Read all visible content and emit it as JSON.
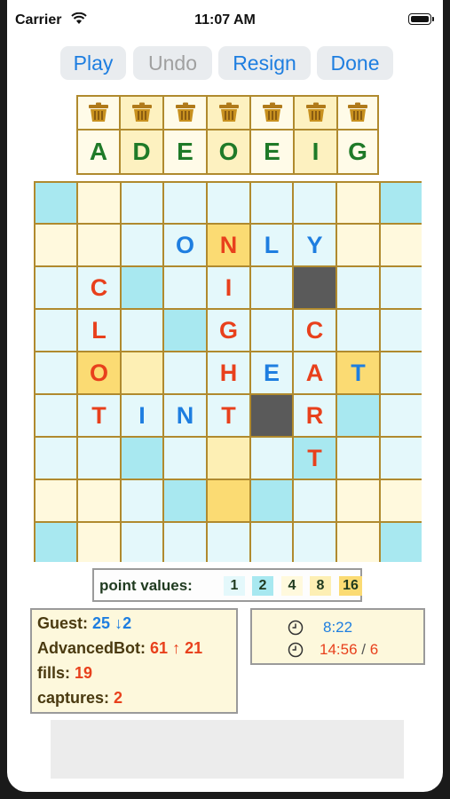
{
  "status_bar": {
    "carrier": "Carrier",
    "time": "11:07 AM"
  },
  "toolbar": {
    "play": "Play",
    "undo": "Undo",
    "resign": "Resign",
    "done": "Done"
  },
  "tray": {
    "letters": [
      "A",
      "D",
      "E",
      "O",
      "E",
      "I",
      "G"
    ],
    "highlighted": [
      false,
      true,
      false,
      true,
      false,
      true,
      false
    ],
    "trash_icon": "trash-basket-icon"
  },
  "board": {
    "size": 9,
    "rows": [
      [
        "",
        "",
        "",
        "",
        "",
        "",
        "",
        "",
        ""
      ],
      [
        "",
        "",
        "",
        "O",
        "N",
        "L",
        "Y",
        "",
        ""
      ],
      [
        "",
        "C",
        "",
        "",
        "I",
        "",
        "",
        "",
        ""
      ],
      [
        "",
        "L",
        "",
        "",
        "G",
        "",
        "C",
        "",
        ""
      ],
      [
        "",
        "O",
        "",
        "",
        "H",
        "E",
        "A",
        "T",
        ""
      ],
      [
        "",
        "T",
        "I",
        "N",
        "T",
        "",
        "R",
        "",
        ""
      ],
      [
        "",
        "",
        "",
        "",
        "",
        "",
        "T",
        "",
        ""
      ],
      [
        "",
        "",
        "",
        "",
        "",
        "",
        "",
        "",
        ""
      ],
      [
        "",
        "",
        "",
        "",
        "",
        "",
        "",
        "",
        ""
      ]
    ],
    "colors": {
      "cyan": "#a8e8f0",
      "lightcyan": "#e4f8fb",
      "yellow": "#fff9dd",
      "tan": "#fdefb4",
      "gold": "#fbdb73",
      "blocked": "#5a5a5a",
      "red_letter": "#e8401c",
      "blue_letter": "#1e7ee0"
    }
  },
  "legend": {
    "label": "point values:",
    "values": [
      "1",
      "2",
      "4",
      "8",
      "16"
    ]
  },
  "scores": {
    "guest_label": "Guest:",
    "guest_score": "25",
    "guest_arrow": "↓",
    "guest_delta": "2",
    "bot_label": "AdvancedBot:",
    "bot_score": "61",
    "bot_arrow": "↑",
    "bot_delta": "21",
    "fills_label": "fills:",
    "fills_value": "19",
    "captures_label": "captures:",
    "captures_value": "2"
  },
  "timers": {
    "guest_time": "8:22",
    "bot_time": "14:56",
    "separator": "/",
    "bot_count": "6"
  }
}
